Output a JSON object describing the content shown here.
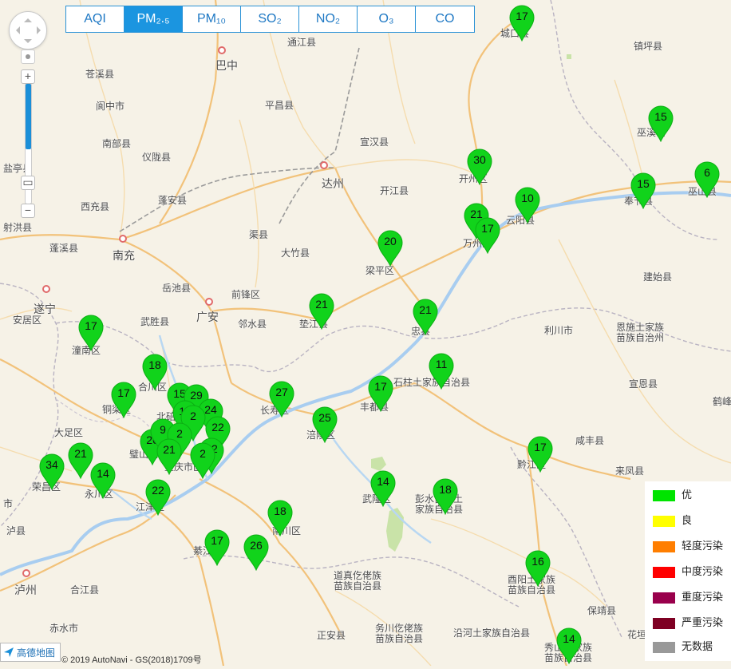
{
  "tabs": [
    {
      "label": "AQI",
      "active": false
    },
    {
      "label": "PM₂.₅",
      "active": true
    },
    {
      "label": "PM₁₀",
      "active": false
    },
    {
      "label": "SO₂",
      "active": false
    },
    {
      "label": "NO₂",
      "active": false
    },
    {
      "label": "O₃",
      "active": false
    },
    {
      "label": "CO",
      "active": false
    }
  ],
  "zoom_controls": {
    "plus": "+",
    "minus": "−"
  },
  "legend": [
    {
      "label": "优",
      "color": "#00e400"
    },
    {
      "label": "良",
      "color": "#ffff00"
    },
    {
      "label": "轻度污染",
      "color": "#ff7e00"
    },
    {
      "label": "中度污染",
      "color": "#ff0000"
    },
    {
      "label": "重度污染",
      "color": "#99004c"
    },
    {
      "label": "严重污染",
      "color": "#7e0023"
    },
    {
      "label": "无数据",
      "color": "#999999"
    }
  ],
  "logo_text": "高德地图",
  "copyright": "© 2019 AutoNavi - GS(2018)1709号",
  "places": [
    "通江县",
    "巴中",
    "苍溪县",
    "镇坪县",
    "阆中市",
    "平昌县",
    "南部县",
    "宣汉县",
    "仪陇县",
    "盐亭县",
    "达州",
    "开江县",
    "蓬安县",
    "西充县",
    "射洪县",
    "渠县",
    "蓬溪县",
    "南充",
    "大竹县",
    "梁平区",
    "建始县",
    "岳池县",
    "遂宁",
    "前锋区",
    "广安",
    "安居区",
    "武胜县",
    "邻水县",
    "垫江县",
    "利川市",
    "恩施土家族",
    "苗族自治州",
    "潼南区",
    "石柱土家族自治县",
    "合川区",
    "宣恩县",
    "铜梁区",
    "北碚区",
    "丰都县",
    "长寿区",
    "咸丰县",
    "鹤峰",
    "大足区",
    "涪陵区",
    "璧山区",
    "来凤县",
    "荣昌区",
    "永川区",
    "武隆区",
    "彭水苗族土",
    "家族自治县",
    "江津区",
    "綦江区",
    "南川区",
    "泸县",
    "泸州",
    "道真仡佬族",
    "苗族自治县",
    "合江县",
    "酉阳土家族",
    "苗族自治县",
    "赤水市",
    "务川仡佬族",
    "苗族自治县",
    "正安县",
    "沿河土家族自治县",
    "保靖县",
    "秀山土家族",
    "苗族自治县",
    "花垣县",
    "城口县",
    "巫溪县",
    "奉节县",
    "巫山县",
    "开州区",
    "云阳县",
    "万州区",
    "忠县",
    "黔江区",
    "重庆市区",
    "市"
  ],
  "markers": [
    {
      "value": "17"
    },
    {
      "value": "15"
    },
    {
      "value": "6"
    },
    {
      "value": "15"
    },
    {
      "value": "30"
    },
    {
      "value": "10"
    },
    {
      "value": "21"
    },
    {
      "value": "17"
    },
    {
      "value": "20"
    },
    {
      "value": "21"
    },
    {
      "value": "21"
    },
    {
      "value": "17"
    },
    {
      "value": "18"
    },
    {
      "value": "11"
    },
    {
      "value": "17"
    },
    {
      "value": "27"
    },
    {
      "value": "25"
    },
    {
      "value": "17"
    },
    {
      "value": "15"
    },
    {
      "value": "29"
    },
    {
      "value": "24"
    },
    {
      "value": "13"
    },
    {
      "value": "2"
    },
    {
      "value": "22"
    },
    {
      "value": "26"
    },
    {
      "value": "9"
    },
    {
      "value": "2"
    },
    {
      "value": "21"
    },
    {
      "value": "22"
    },
    {
      "value": "2"
    },
    {
      "value": "21"
    },
    {
      "value": "34"
    },
    {
      "value": "14"
    },
    {
      "value": "22"
    },
    {
      "value": "14"
    },
    {
      "value": "18"
    },
    {
      "value": "18"
    },
    {
      "value": "17"
    },
    {
      "value": "26"
    },
    {
      "value": "16"
    },
    {
      "value": "14"
    },
    {
      "value": "17"
    }
  ]
}
